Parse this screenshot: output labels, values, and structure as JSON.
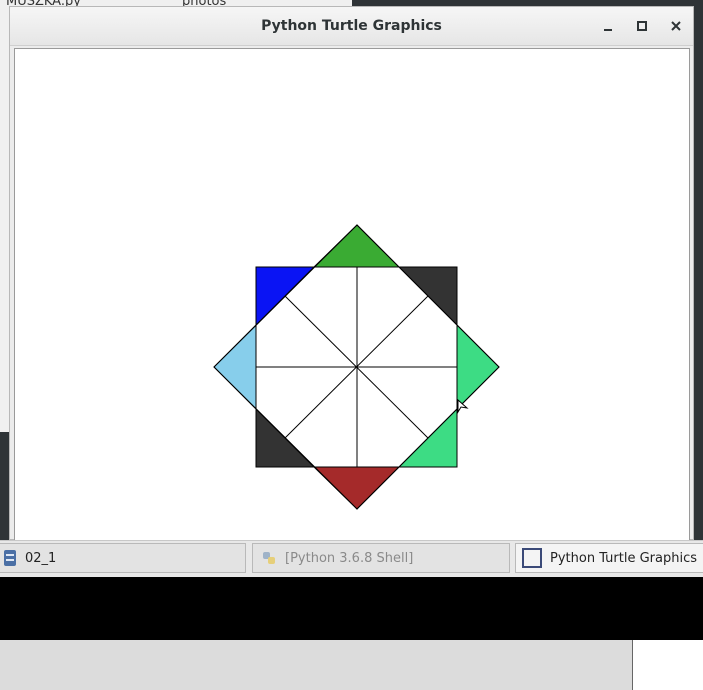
{
  "background_window": {
    "file_label": "MUSZKA.py",
    "folder_label": "photos"
  },
  "window": {
    "title": "Python Turtle Graphics",
    "buttons": {
      "minimize": "minimize-icon",
      "maximize": "maximize-icon",
      "close": "close-icon"
    }
  },
  "drawing": {
    "colors": {
      "top": "#3aab33",
      "top_left": "#0a14f4",
      "top_right": "#333333",
      "left": "#87ceeb",
      "right": "#3ddc84",
      "bottom_left": "#333333",
      "bottom_right": "#3ddc84",
      "bottom": "#a52a2a"
    }
  },
  "taskbar": {
    "items": [
      {
        "label": "02_1",
        "icon": "file-manager-icon"
      },
      {
        "label": "[Python 3.6.8 Shell]",
        "icon": "python-icon"
      },
      {
        "label": "Python Turtle Graphics",
        "icon": "window-icon"
      }
    ]
  }
}
